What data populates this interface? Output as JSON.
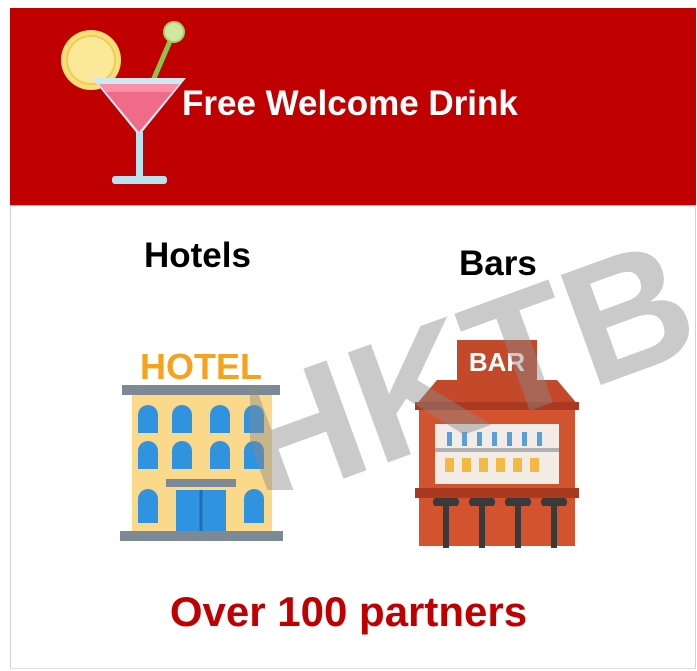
{
  "header": {
    "title": "Free Welcome Drink",
    "icon": "cocktail-icon",
    "background": "#c00000"
  },
  "categories": [
    {
      "label": "Hotels",
      "icon": "hotel-icon",
      "sign": "HOTEL"
    },
    {
      "label": "Bars",
      "icon": "bar-icon",
      "sign": "BAR"
    }
  ],
  "watermark": "HKTB",
  "tagline": "Over 100 partners",
  "accent_color": "#c00000"
}
